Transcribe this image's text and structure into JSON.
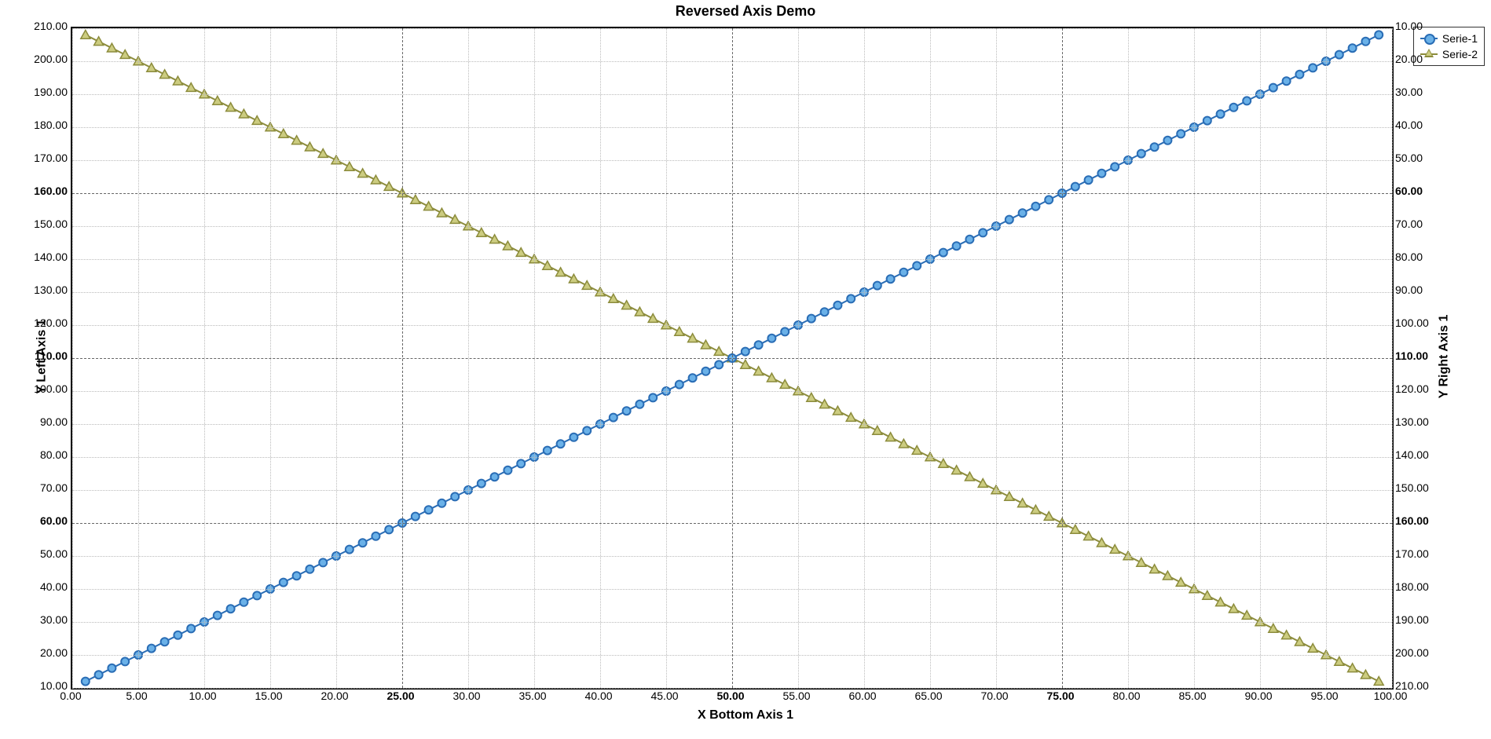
{
  "title": "Reversed Axis Demo",
  "xlabel": "X Bottom Axis 1",
  "ylabel_left": "Y Left Axis 1",
  "ylabel_right": "Y Right Axis 1",
  "legend": {
    "s1": "Serie-1",
    "s2": "Serie-2"
  },
  "colors": {
    "serie1_line": "#2a6db5",
    "serie1_fill": "#6ab1e8",
    "serie2_line": "#8c8c3c",
    "serie2_fill": "#cccc80"
  },
  "chart_data": {
    "type": "line",
    "title": "Reversed Axis Demo",
    "xlabel": "X Bottom Axis 1",
    "ylabel_left": "Y Left Axis 1",
    "ylabel_right": "Y Right Axis 1",
    "x_range": [
      0,
      100
    ],
    "y_left_range": [
      10,
      210
    ],
    "y_right_range_reversed": [
      10,
      210
    ],
    "x_ticks": [
      0,
      5,
      10,
      15,
      20,
      25,
      30,
      35,
      40,
      45,
      50,
      55,
      60,
      65,
      70,
      75,
      80,
      85,
      90,
      95,
      100
    ],
    "x_major": [
      25,
      50,
      75
    ],
    "y_left_ticks": [
      10,
      20,
      30,
      40,
      50,
      60,
      70,
      80,
      90,
      100,
      110,
      120,
      130,
      140,
      150,
      160,
      170,
      180,
      190,
      200,
      210
    ],
    "y_left_major": [
      60,
      110,
      160
    ],
    "y_right_ticks": [
      10,
      20,
      30,
      40,
      50,
      60,
      70,
      80,
      90,
      100,
      110,
      120,
      130,
      140,
      150,
      160,
      170,
      180,
      190,
      200,
      210
    ],
    "y_right_major": [
      60,
      110,
      160
    ],
    "tick_label_format": "0.00",
    "series": [
      {
        "name": "Serie-1",
        "axis": "left",
        "marker": "circle",
        "color": "#2a6db5",
        "x": [
          1,
          2,
          3,
          4,
          5,
          6,
          7,
          8,
          9,
          10,
          11,
          12,
          13,
          14,
          15,
          16,
          17,
          18,
          19,
          20,
          21,
          22,
          23,
          24,
          25,
          26,
          27,
          28,
          29,
          30,
          31,
          32,
          33,
          34,
          35,
          36,
          37,
          38,
          39,
          40,
          41,
          42,
          43,
          44,
          45,
          46,
          47,
          48,
          49,
          50,
          51,
          52,
          53,
          54,
          55,
          56,
          57,
          58,
          59,
          60,
          61,
          62,
          63,
          64,
          65,
          66,
          67,
          68,
          69,
          70,
          71,
          72,
          73,
          74,
          75,
          76,
          77,
          78,
          79,
          80,
          81,
          82,
          83,
          84,
          85,
          86,
          87,
          88,
          89,
          90,
          91,
          92,
          93,
          94,
          95,
          96,
          97,
          98,
          99
        ],
        "y": [
          12,
          14,
          16,
          18,
          20,
          22,
          24,
          26,
          28,
          30,
          32,
          34,
          36,
          38,
          40,
          42,
          44,
          46,
          48,
          50,
          52,
          54,
          56,
          58,
          60,
          62,
          64,
          66,
          68,
          70,
          72,
          74,
          76,
          78,
          80,
          82,
          84,
          86,
          88,
          90,
          92,
          94,
          96,
          98,
          100,
          102,
          104,
          106,
          108,
          110,
          112,
          114,
          116,
          118,
          120,
          122,
          124,
          126,
          128,
          130,
          132,
          134,
          136,
          138,
          140,
          142,
          144,
          146,
          148,
          150,
          152,
          154,
          156,
          158,
          160,
          162,
          164,
          166,
          168,
          170,
          172,
          174,
          176,
          178,
          180,
          182,
          184,
          186,
          188,
          190,
          192,
          194,
          196,
          198,
          200,
          202,
          204,
          206,
          208
        ]
      },
      {
        "name": "Serie-2",
        "axis": "right",
        "marker": "triangle",
        "color": "#8c8c3c",
        "note": "right axis is reversed (10 at top, 210 at bottom)",
        "x": [
          1,
          2,
          3,
          4,
          5,
          6,
          7,
          8,
          9,
          10,
          11,
          12,
          13,
          14,
          15,
          16,
          17,
          18,
          19,
          20,
          21,
          22,
          23,
          24,
          25,
          26,
          27,
          28,
          29,
          30,
          31,
          32,
          33,
          34,
          35,
          36,
          37,
          38,
          39,
          40,
          41,
          42,
          43,
          44,
          45,
          46,
          47,
          48,
          49,
          50,
          51,
          52,
          53,
          54,
          55,
          56,
          57,
          58,
          59,
          60,
          61,
          62,
          63,
          64,
          65,
          66,
          67,
          68,
          69,
          70,
          71,
          72,
          73,
          74,
          75,
          76,
          77,
          78,
          79,
          80,
          81,
          82,
          83,
          84,
          85,
          86,
          87,
          88,
          89,
          90,
          91,
          92,
          93,
          94,
          95,
          96,
          97,
          98,
          99
        ],
        "y": [
          12,
          14,
          16,
          18,
          20,
          22,
          24,
          26,
          28,
          30,
          32,
          34,
          36,
          38,
          40,
          42,
          44,
          46,
          48,
          50,
          52,
          54,
          56,
          58,
          60,
          62,
          64,
          66,
          68,
          70,
          72,
          74,
          76,
          78,
          80,
          82,
          84,
          86,
          88,
          90,
          92,
          94,
          96,
          98,
          100,
          102,
          104,
          106,
          108,
          110,
          112,
          114,
          116,
          118,
          120,
          122,
          124,
          126,
          128,
          130,
          132,
          134,
          136,
          138,
          140,
          142,
          144,
          146,
          148,
          150,
          152,
          154,
          156,
          158,
          160,
          162,
          164,
          166,
          168,
          170,
          172,
          174,
          176,
          178,
          180,
          182,
          184,
          186,
          188,
          190,
          192,
          194,
          196,
          198,
          200,
          202,
          204,
          206,
          208
        ]
      }
    ]
  }
}
